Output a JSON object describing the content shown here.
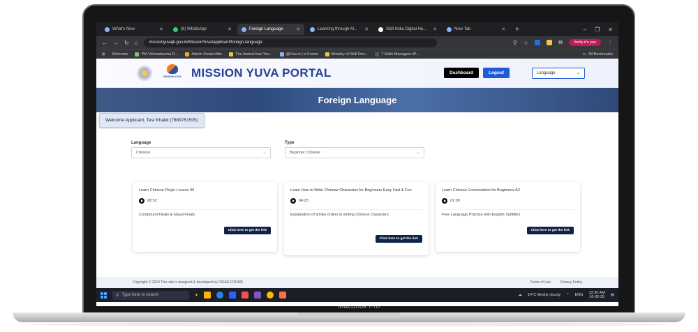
{
  "browser": {
    "tabs": [
      {
        "label": "What's New",
        "active": false
      },
      {
        "label": "(6) WhatsApp",
        "active": false
      },
      {
        "label": "Foreign Language",
        "active": true
      },
      {
        "label": "Learning through M...",
        "active": false
      },
      {
        "label": "Skill India Digital Hu...",
        "active": false
      },
      {
        "label": "New Tab",
        "active": false
      }
    ],
    "url": "missionyuvajk.gov.in/MissionYuva/applicant/foreign-language",
    "verify_label": "Verify it's you",
    "bookmarks": [
      "Welcome",
      "PM Vishwakarma D...",
      "Admin Gmail offer",
      "The fastest free You...",
      "@Gov.in | e-Forms",
      "Ministry of Skill Dev...",
      "7 Skills Managers W..."
    ],
    "all_bookmarks": "All Bookmarks"
  },
  "header": {
    "portal_title": "MISSION YUVA PORTAL",
    "logo_caption": "MISSION YUVA",
    "dashboard_label": "Dashboard",
    "logout_label": "Logout",
    "language_select": "Language"
  },
  "banner": {
    "title": "Foreign Language"
  },
  "welcome_text": "Welcome Applicant, Test Khalid (7889751505)",
  "filters": {
    "language_label": "Language",
    "language_value": "Chinese",
    "type_label": "Type",
    "type_value": "Beginner Chinese"
  },
  "cards": [
    {
      "title": "Learn Chinese Pinyin Lesson 09",
      "duration": "08:52",
      "description": "Compound Finals & Nasal Finals",
      "button": "Click here to get the link"
    },
    {
      "title": "Learn How to Write Chinese Characters for Beginners Easy Fast & Fun",
      "duration": "04:23",
      "description": "Explanation of stroke orders in writing Chinese characters",
      "button": "Click here to get the link"
    },
    {
      "title": "Learn Chinese Conversation for Beginners A2",
      "duration": "01:09",
      "description": "Free Language Practice with English Subtitles",
      "button": "Click here to get the link"
    }
  ],
  "footer": {
    "copyright": "Copyright © 2024 This site is designed & developed by DIGAS-FORMS",
    "terms": "Terms of Use",
    "privacy": "Privacy Policy"
  },
  "taskbar": {
    "search_placeholder": "Type here to search",
    "weather": "14°C  Mostly cloudy",
    "lang": "ENG",
    "time": "12:30 AM",
    "date": "16-02-25"
  },
  "device_label": "MacBook Pro"
}
